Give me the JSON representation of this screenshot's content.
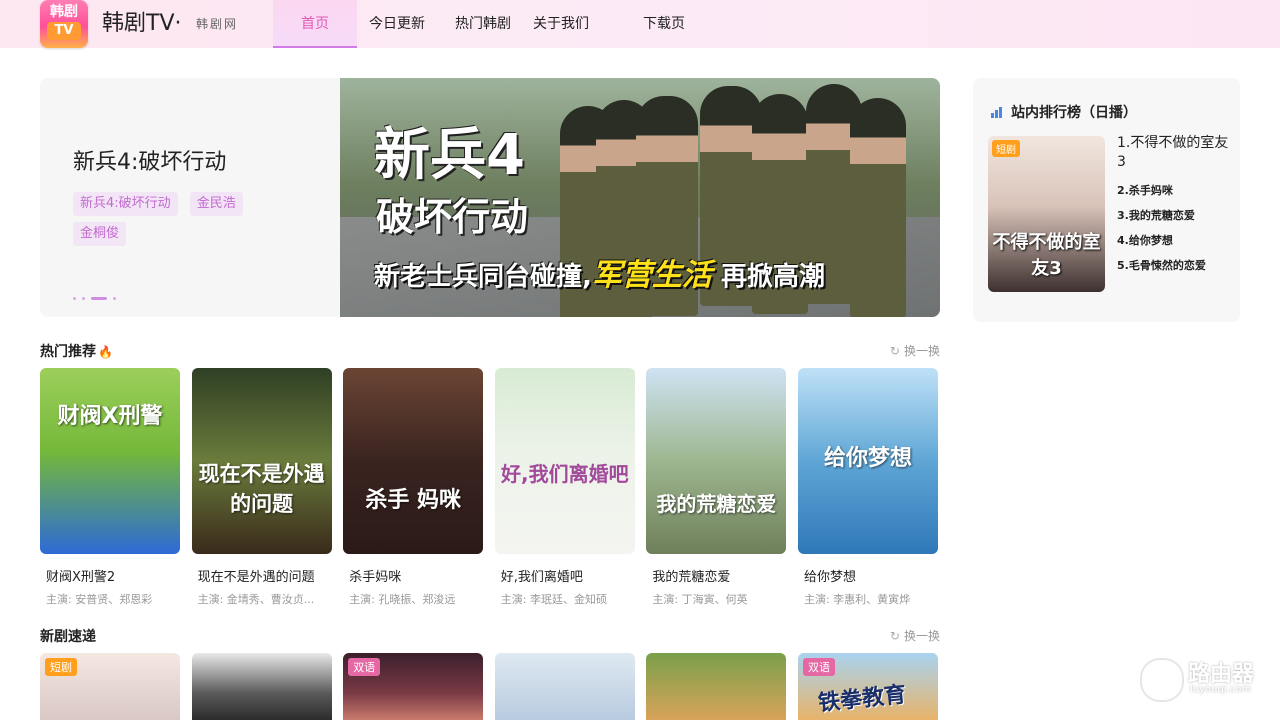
{
  "header": {
    "logo_line1": "韩剧",
    "logo_line2": "TV",
    "site_name": "韩剧TV·",
    "site_sub": "韩剧网",
    "nav": [
      {
        "label": "首页",
        "active": true
      },
      {
        "label": "今日更新"
      },
      {
        "label": "热门韩剧"
      },
      {
        "label": "关于我们"
      },
      {
        "label": "下载页"
      }
    ]
  },
  "banner": {
    "title": "新兵4:破坏行动",
    "tags": [
      "新兵4:破坏行动",
      "金民浩",
      "金桐俊"
    ],
    "poster_line1": "新兵4",
    "poster_line2": "破坏行动",
    "poster_line3a": "新老士兵同台碰撞,",
    "poster_line3b": "军营生活",
    "poster_line3c": "再掀高潮"
  },
  "ranking": {
    "title": "站内排行榜（日播）",
    "thumb_badge": "短剧",
    "thumb_title": "不得不做的室友3",
    "items": [
      "1.不得不做的室友3",
      "2.杀手妈咪",
      "3.我的荒糖恋爱",
      "4.给你梦想",
      "5.毛骨悚然的恋爱"
    ]
  },
  "hot": {
    "title": "热门推荐",
    "refresh": "换一换",
    "cards": [
      {
        "title": "财阀X刑警2",
        "cast": "主演: 安普贤、郑恩彩",
        "poster_text": "财阀X刑警"
      },
      {
        "title": "现在不是外遇的问题",
        "cast": "主演: 金埥秀、曹汝贞...",
        "poster_text": "现在不是外遇的问题"
      },
      {
        "title": "杀手妈咪",
        "cast": "主演: 孔晓振、郑浚远",
        "poster_text": "杀手 妈咪"
      },
      {
        "title": "好,我们离婚吧",
        "cast": "主演: 李珉廷、金知硕",
        "poster_text": "好,我们离婚吧"
      },
      {
        "title": "我的荒糖恋爱",
        "cast": "主演: 丁海寅、何英",
        "poster_text": "我的荒糖恋爱"
      },
      {
        "title": "给你梦想",
        "cast": "主演: 李惠利、黄寅烨",
        "poster_text": "给你梦想"
      }
    ]
  },
  "new": {
    "title": "新剧速递",
    "refresh": "换一换",
    "cards": [
      {
        "badge": "短剧"
      },
      {
        "badge": ""
      },
      {
        "badge": "双语"
      },
      {
        "badge": ""
      },
      {
        "badge": ""
      },
      {
        "badge": "双语",
        "poster_text": "铁拳教育"
      }
    ]
  },
  "watermark": {
    "text": "路由器",
    "sub": "luyouqi.com"
  }
}
